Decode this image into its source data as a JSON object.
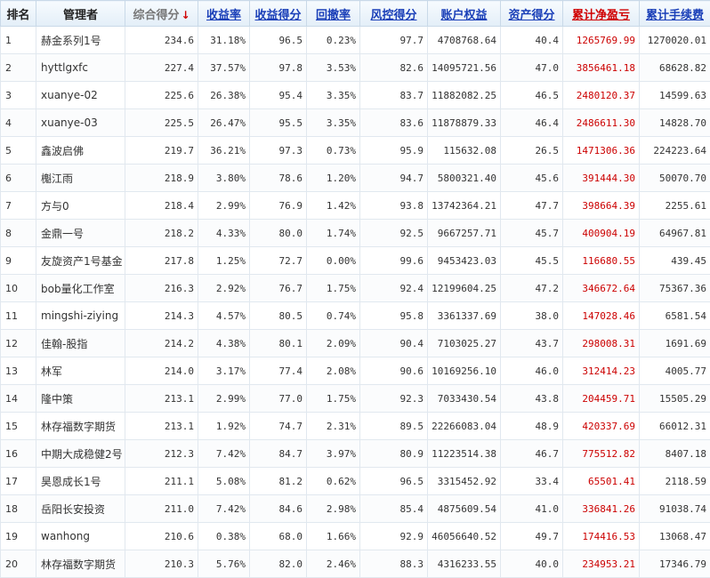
{
  "headers": {
    "rank": "排名",
    "manager": "管理者",
    "score": "综合得分",
    "return_rate": "收益率",
    "return_score": "收益得分",
    "drawdown": "回撤率",
    "risk_score": "风控得分",
    "equity": "账户权益",
    "asset_score": "资产得分",
    "cum_pnl": "累计净盈亏",
    "cum_fee": "累计手续费"
  },
  "sort_icon": "↓",
  "colors": {
    "link": "#1a3fb8",
    "negative_highlight": "#cc0000"
  },
  "rows": [
    {
      "rank": "1",
      "manager": "赫金系列1号",
      "score": "234.6",
      "return_rate": "31.18%",
      "return_score": "96.5",
      "drawdown": "0.23%",
      "risk_score": "97.7",
      "equity": "4708768.64",
      "asset_score": "40.4",
      "cum_pnl": "1265769.99",
      "cum_fee": "1270020.01"
    },
    {
      "rank": "2",
      "manager": "hyttlgxfc",
      "score": "227.4",
      "return_rate": "37.57%",
      "return_score": "97.8",
      "drawdown": "3.53%",
      "risk_score": "82.6",
      "equity": "14095721.56",
      "asset_score": "47.0",
      "cum_pnl": "3856461.18",
      "cum_fee": "68628.82"
    },
    {
      "rank": "3",
      "manager": "xuanye-02",
      "score": "225.6",
      "return_rate": "26.38%",
      "return_score": "95.4",
      "drawdown": "3.35%",
      "risk_score": "83.7",
      "equity": "11882082.25",
      "asset_score": "46.5",
      "cum_pnl": "2480120.37",
      "cum_fee": "14599.63"
    },
    {
      "rank": "4",
      "manager": "xuanye-03",
      "score": "225.5",
      "return_rate": "26.47%",
      "return_score": "95.5",
      "drawdown": "3.35%",
      "risk_score": "83.6",
      "equity": "11878879.33",
      "asset_score": "46.4",
      "cum_pnl": "2486611.30",
      "cum_fee": "14828.70"
    },
    {
      "rank": "5",
      "manager": "鑫波启佛",
      "score": "219.7",
      "return_rate": "36.21%",
      "return_score": "97.3",
      "drawdown": "0.73%",
      "risk_score": "95.9",
      "equity": "115632.08",
      "asset_score": "26.5",
      "cum_pnl": "1471306.36",
      "cum_fee": "224223.64"
    },
    {
      "rank": "6",
      "manager": "櫆江雨",
      "score": "218.9",
      "return_rate": "3.80%",
      "return_score": "78.6",
      "drawdown": "1.20%",
      "risk_score": "94.7",
      "equity": "5800321.40",
      "asset_score": "45.6",
      "cum_pnl": "391444.30",
      "cum_fee": "50070.70"
    },
    {
      "rank": "7",
      "manager": "方与0",
      "score": "218.4",
      "return_rate": "2.99%",
      "return_score": "76.9",
      "drawdown": "1.42%",
      "risk_score": "93.8",
      "equity": "13742364.21",
      "asset_score": "47.7",
      "cum_pnl": "398664.39",
      "cum_fee": "2255.61"
    },
    {
      "rank": "8",
      "manager": "金鼎一号",
      "score": "218.2",
      "return_rate": "4.33%",
      "return_score": "80.0",
      "drawdown": "1.74%",
      "risk_score": "92.5",
      "equity": "9667257.71",
      "asset_score": "45.7",
      "cum_pnl": "400904.19",
      "cum_fee": "64967.81"
    },
    {
      "rank": "9",
      "manager": "友旋资产1号基金",
      "score": "217.8",
      "return_rate": "1.25%",
      "return_score": "72.7",
      "drawdown": "0.00%",
      "risk_score": "99.6",
      "equity": "9453423.03",
      "asset_score": "45.5",
      "cum_pnl": "116680.55",
      "cum_fee": "439.45"
    },
    {
      "rank": "10",
      "manager": "bob量化工作室",
      "score": "216.3",
      "return_rate": "2.92%",
      "return_score": "76.7",
      "drawdown": "1.75%",
      "risk_score": "92.4",
      "equity": "12199604.25",
      "asset_score": "47.2",
      "cum_pnl": "346672.64",
      "cum_fee": "75367.36"
    },
    {
      "rank": "11",
      "manager": "mingshi-ziying",
      "score": "214.3",
      "return_rate": "4.57%",
      "return_score": "80.5",
      "drawdown": "0.74%",
      "risk_score": "95.8",
      "equity": "3361337.69",
      "asset_score": "38.0",
      "cum_pnl": "147028.46",
      "cum_fee": "6581.54"
    },
    {
      "rank": "12",
      "manager": "佳翰-股指",
      "score": "214.2",
      "return_rate": "4.38%",
      "return_score": "80.1",
      "drawdown": "2.09%",
      "risk_score": "90.4",
      "equity": "7103025.27",
      "asset_score": "43.7",
      "cum_pnl": "298008.31",
      "cum_fee": "1691.69"
    },
    {
      "rank": "13",
      "manager": "林军",
      "score": "214.0",
      "return_rate": "3.17%",
      "return_score": "77.4",
      "drawdown": "2.08%",
      "risk_score": "90.6",
      "equity": "10169256.10",
      "asset_score": "46.0",
      "cum_pnl": "312414.23",
      "cum_fee": "4005.77"
    },
    {
      "rank": "14",
      "manager": "隆中策",
      "score": "213.1",
      "return_rate": "2.99%",
      "return_score": "77.0",
      "drawdown": "1.75%",
      "risk_score": "92.3",
      "equity": "7033430.54",
      "asset_score": "43.8",
      "cum_pnl": "204459.71",
      "cum_fee": "15505.29"
    },
    {
      "rank": "15",
      "manager": "林存福数字期货",
      "score": "213.1",
      "return_rate": "1.92%",
      "return_score": "74.7",
      "drawdown": "2.31%",
      "risk_score": "89.5",
      "equity": "22266083.04",
      "asset_score": "48.9",
      "cum_pnl": "420337.69",
      "cum_fee": "66012.31"
    },
    {
      "rank": "16",
      "manager": "中期大成稳健2号",
      "score": "212.3",
      "return_rate": "7.42%",
      "return_score": "84.7",
      "drawdown": "3.97%",
      "risk_score": "80.9",
      "equity": "11223514.38",
      "asset_score": "46.7",
      "cum_pnl": "775512.82",
      "cum_fee": "8407.18"
    },
    {
      "rank": "17",
      "manager": "昊恩成长1号",
      "score": "211.1",
      "return_rate": "5.08%",
      "return_score": "81.2",
      "drawdown": "0.62%",
      "risk_score": "96.5",
      "equity": "3315452.92",
      "asset_score": "33.4",
      "cum_pnl": "65501.41",
      "cum_fee": "2118.59"
    },
    {
      "rank": "18",
      "manager": "岳阳长安投资",
      "score": "211.0",
      "return_rate": "7.42%",
      "return_score": "84.6",
      "drawdown": "2.98%",
      "risk_score": "85.4",
      "equity": "4875609.54",
      "asset_score": "41.0",
      "cum_pnl": "336841.26",
      "cum_fee": "91038.74"
    },
    {
      "rank": "19",
      "manager": "wanhong",
      "score": "210.6",
      "return_rate": "0.38%",
      "return_score": "68.0",
      "drawdown": "1.66%",
      "risk_score": "92.9",
      "equity": "46056640.52",
      "asset_score": "49.7",
      "cum_pnl": "174416.53",
      "cum_fee": "13068.47"
    },
    {
      "rank": "20",
      "manager": "林存福数字期货",
      "score": "210.3",
      "return_rate": "5.76%",
      "return_score": "82.0",
      "drawdown": "2.46%",
      "risk_score": "88.3",
      "equity": "4316233.55",
      "asset_score": "40.0",
      "cum_pnl": "234953.21",
      "cum_fee": "17346.79"
    }
  ]
}
